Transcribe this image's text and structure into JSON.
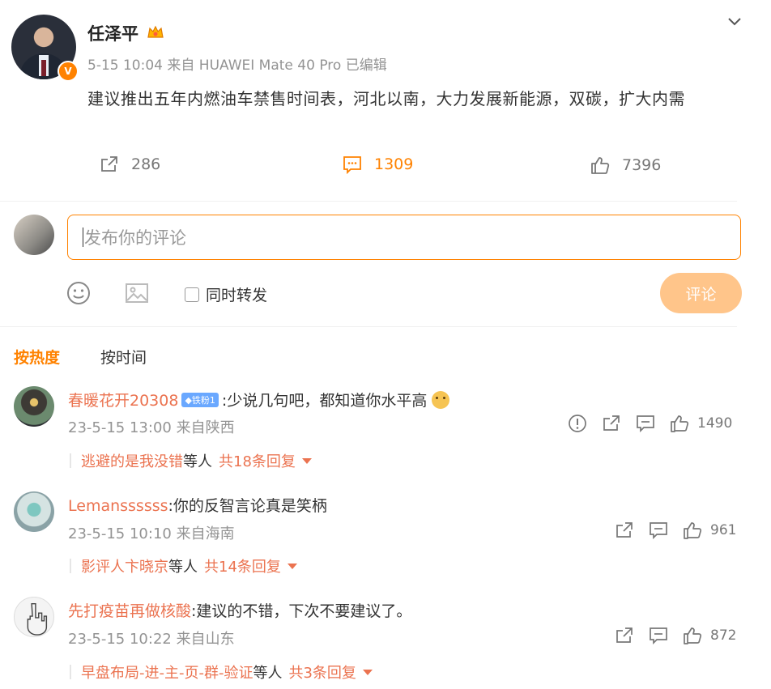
{
  "post": {
    "author": "任泽平",
    "meta": "5-15 10:04  来自 HUAWEI Mate 40 Pro 已编辑",
    "text": "建议推出五年内燃油车禁售时间表，河北以南，大力发展新能源，双碳，扩大内需",
    "verified_badge": "V",
    "actions": {
      "repost_count": "286",
      "comment_count": "1309",
      "like_count": "7396"
    }
  },
  "composer": {
    "placeholder": "发布你的评论",
    "repost_label": "同时转发",
    "submit_label": "评论"
  },
  "sort": {
    "hot_label": "按热度",
    "time_label": "按时间"
  },
  "comments": [
    {
      "user": "春暖花开20308",
      "badge": "◆铁粉1",
      "text": ":少说几句吧，都知道你水平高",
      "meta": "23-5-15 13:00 来自陕西",
      "likes": "1490",
      "reply_user": "逃避的是我没错",
      "reply_mid": " 等人",
      "reply_total": "共18条回复"
    },
    {
      "user": "Lemanssssss",
      "text": ":你的反智言论真是笑柄",
      "meta": "23-5-15 10:10 来自海南",
      "likes": "961",
      "reply_user": "影评人卞晓京",
      "reply_mid": " 等人",
      "reply_total": "共14条回复"
    },
    {
      "user": "先打疫苗再做核酸",
      "text": ":建议的不错，下次不要建议了。",
      "meta": "23-5-15 10:22 来自山东",
      "likes": "872",
      "reply_user": "早盘布局-进-主-页-群-验证",
      "reply_mid": " 等人",
      "reply_total": "共3条回复"
    }
  ],
  "colors": {
    "accent": "#ff8200",
    "username": "#eb7350",
    "submit_disabled": "#ffc58a"
  }
}
